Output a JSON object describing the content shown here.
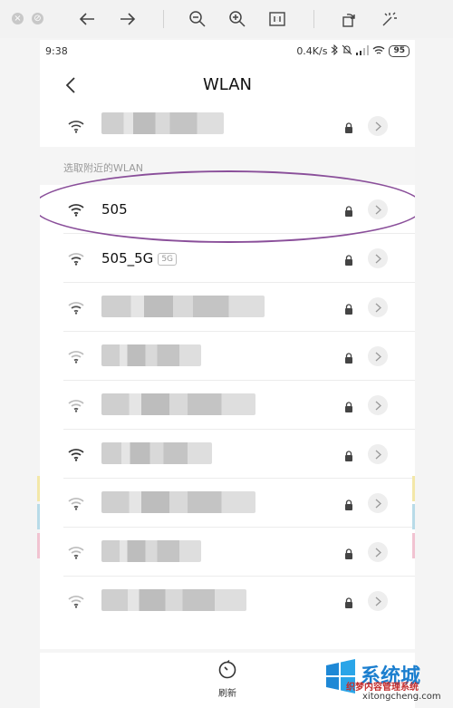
{
  "status": {
    "time": "9:38",
    "speed": "0.4K/s",
    "battery": "95"
  },
  "header": {
    "title": "WLAN"
  },
  "section": {
    "nearby_label": "选取附近的WLAN"
  },
  "networks": [
    {
      "ssid": "505",
      "band": ""
    },
    {
      "ssid": "505_5G",
      "band": "5G"
    }
  ],
  "bottom": {
    "refresh_label": "刷新"
  },
  "watermark": {
    "title": "系统城",
    "subtitle": "织梦内容管理系统",
    "url": "xitongcheng.com"
  },
  "colors": {
    "highlight": "#8a4f9a",
    "accent": "#1c7fcf"
  }
}
